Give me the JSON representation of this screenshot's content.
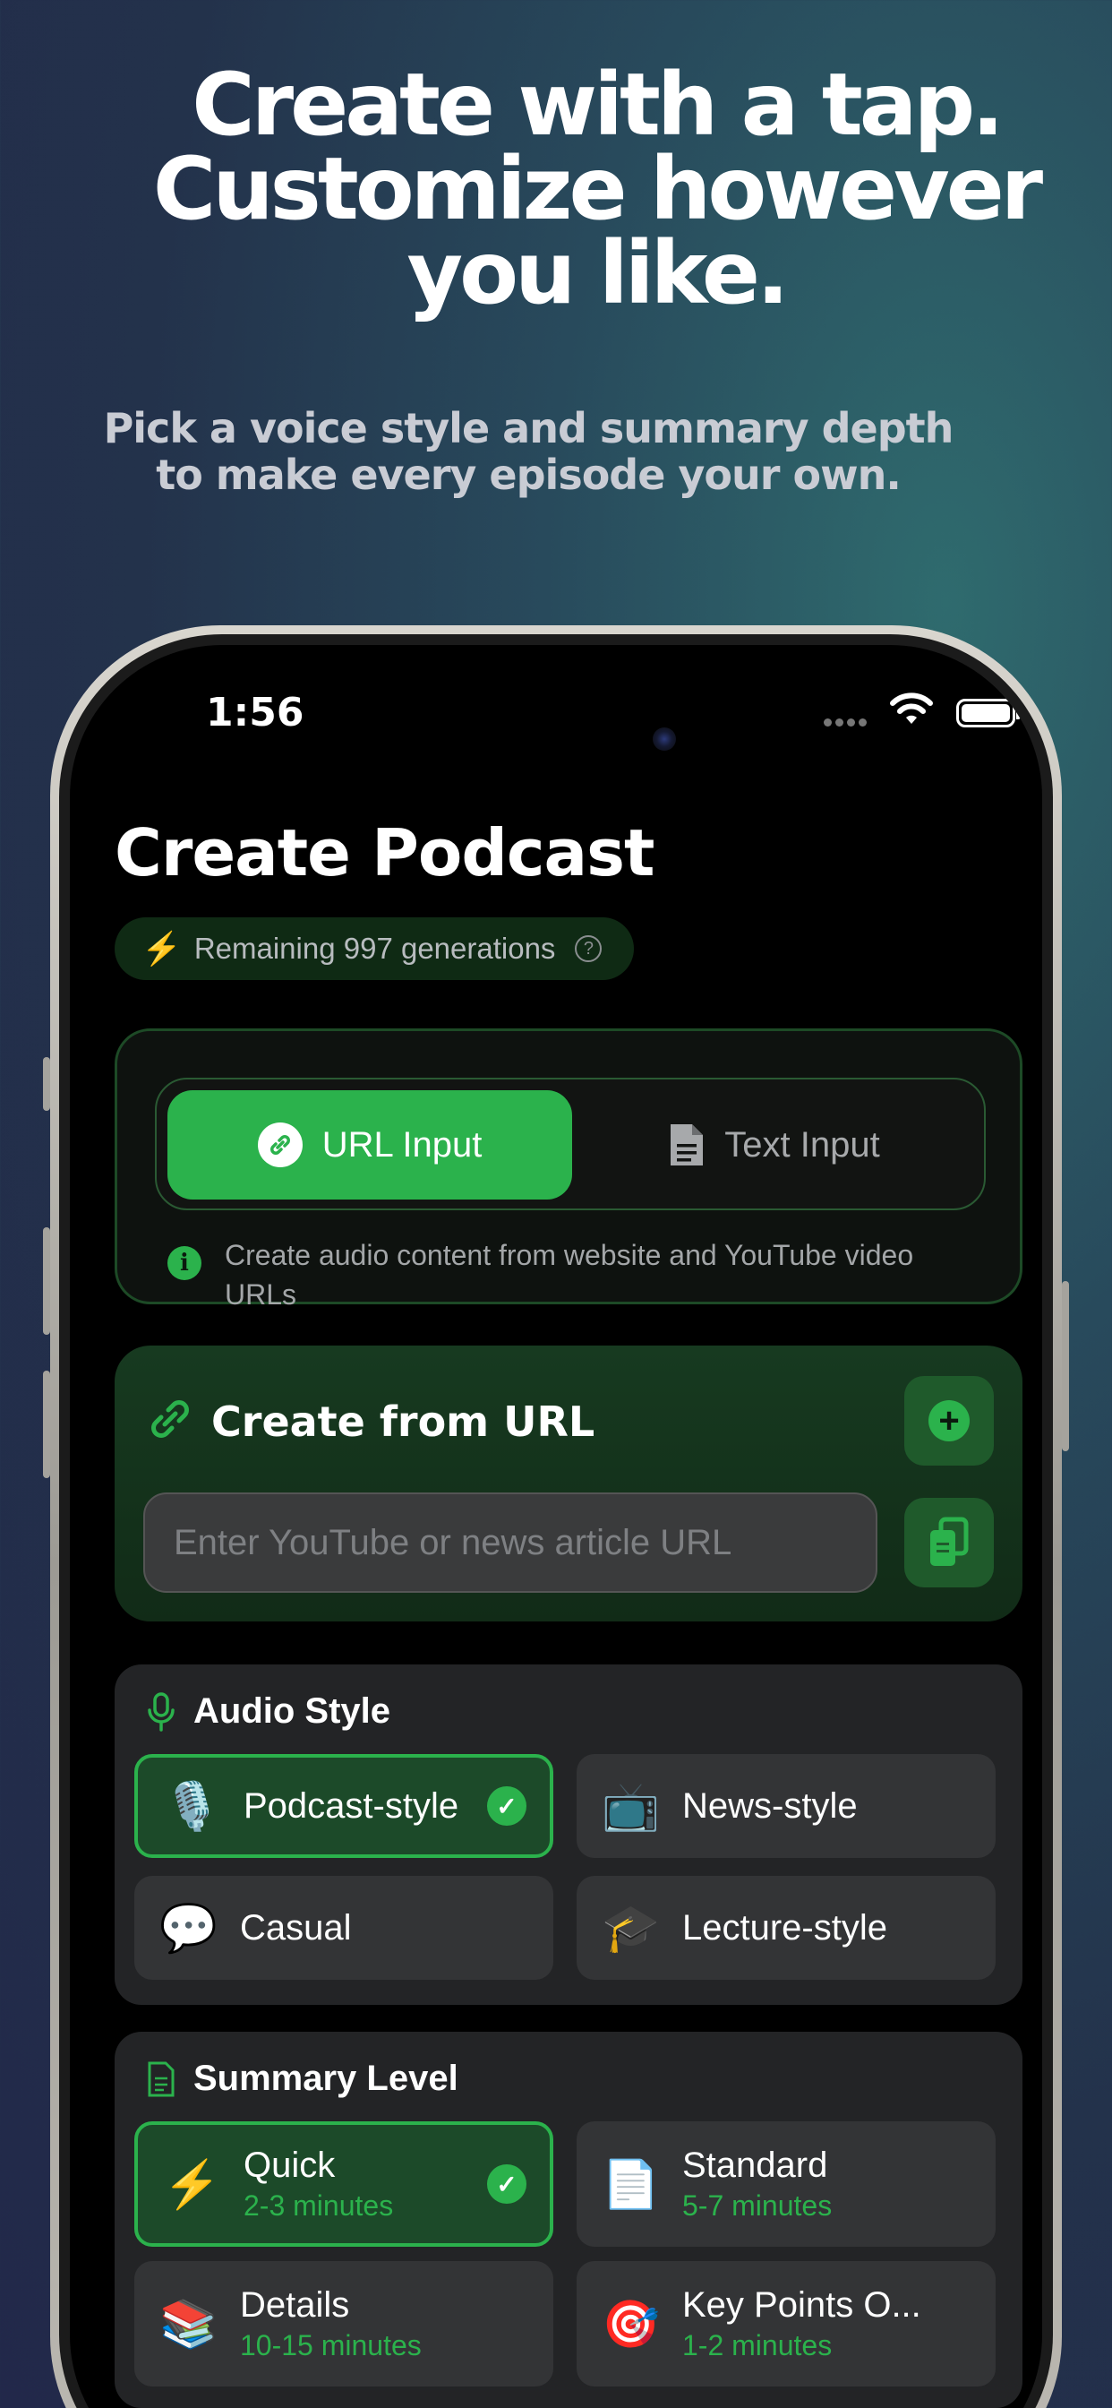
{
  "marketing": {
    "headline_line1": "Create with a tap.",
    "headline_line2": "Customize however",
    "headline_line3": "you like.",
    "subhead_line1": "Pick a voice style and summary depth",
    "subhead_line2": "to make every episode your own."
  },
  "status_bar": {
    "time": "1:56"
  },
  "screen": {
    "title": "Create Podcast",
    "remaining": "Remaining 997 generations"
  },
  "mode": {
    "url_label": "URL Input",
    "text_label": "Text Input",
    "hint": "Create audio content from website and YouTube video URLs"
  },
  "url_card": {
    "title": "Create from URL",
    "placeholder": "Enter YouTube or news article URL"
  },
  "audio_style": {
    "title": "Audio Style",
    "options": [
      {
        "label": "Podcast-style",
        "emoji": "🎙️",
        "selected": true
      },
      {
        "label": "News-style",
        "emoji": "📺",
        "selected": false
      },
      {
        "label": "Casual",
        "emoji": "💬",
        "selected": false
      },
      {
        "label": "Lecture-style",
        "emoji": "🎓",
        "selected": false
      }
    ]
  },
  "summary_level": {
    "title": "Summary Level",
    "options": [
      {
        "label": "Quick",
        "sub": "2-3 minutes",
        "emoji": "⚡",
        "selected": true
      },
      {
        "label": "Standard",
        "sub": "5-7 minutes",
        "emoji": "📄",
        "selected": false
      },
      {
        "label": "Details",
        "sub": "10-15 minutes",
        "emoji": "📚",
        "selected": false
      },
      {
        "label": "Key Points O...",
        "sub": "1-2 minutes",
        "emoji": "🎯",
        "selected": false
      }
    ]
  },
  "colors": {
    "accent": "#2bb24c",
    "background": "#000000"
  }
}
